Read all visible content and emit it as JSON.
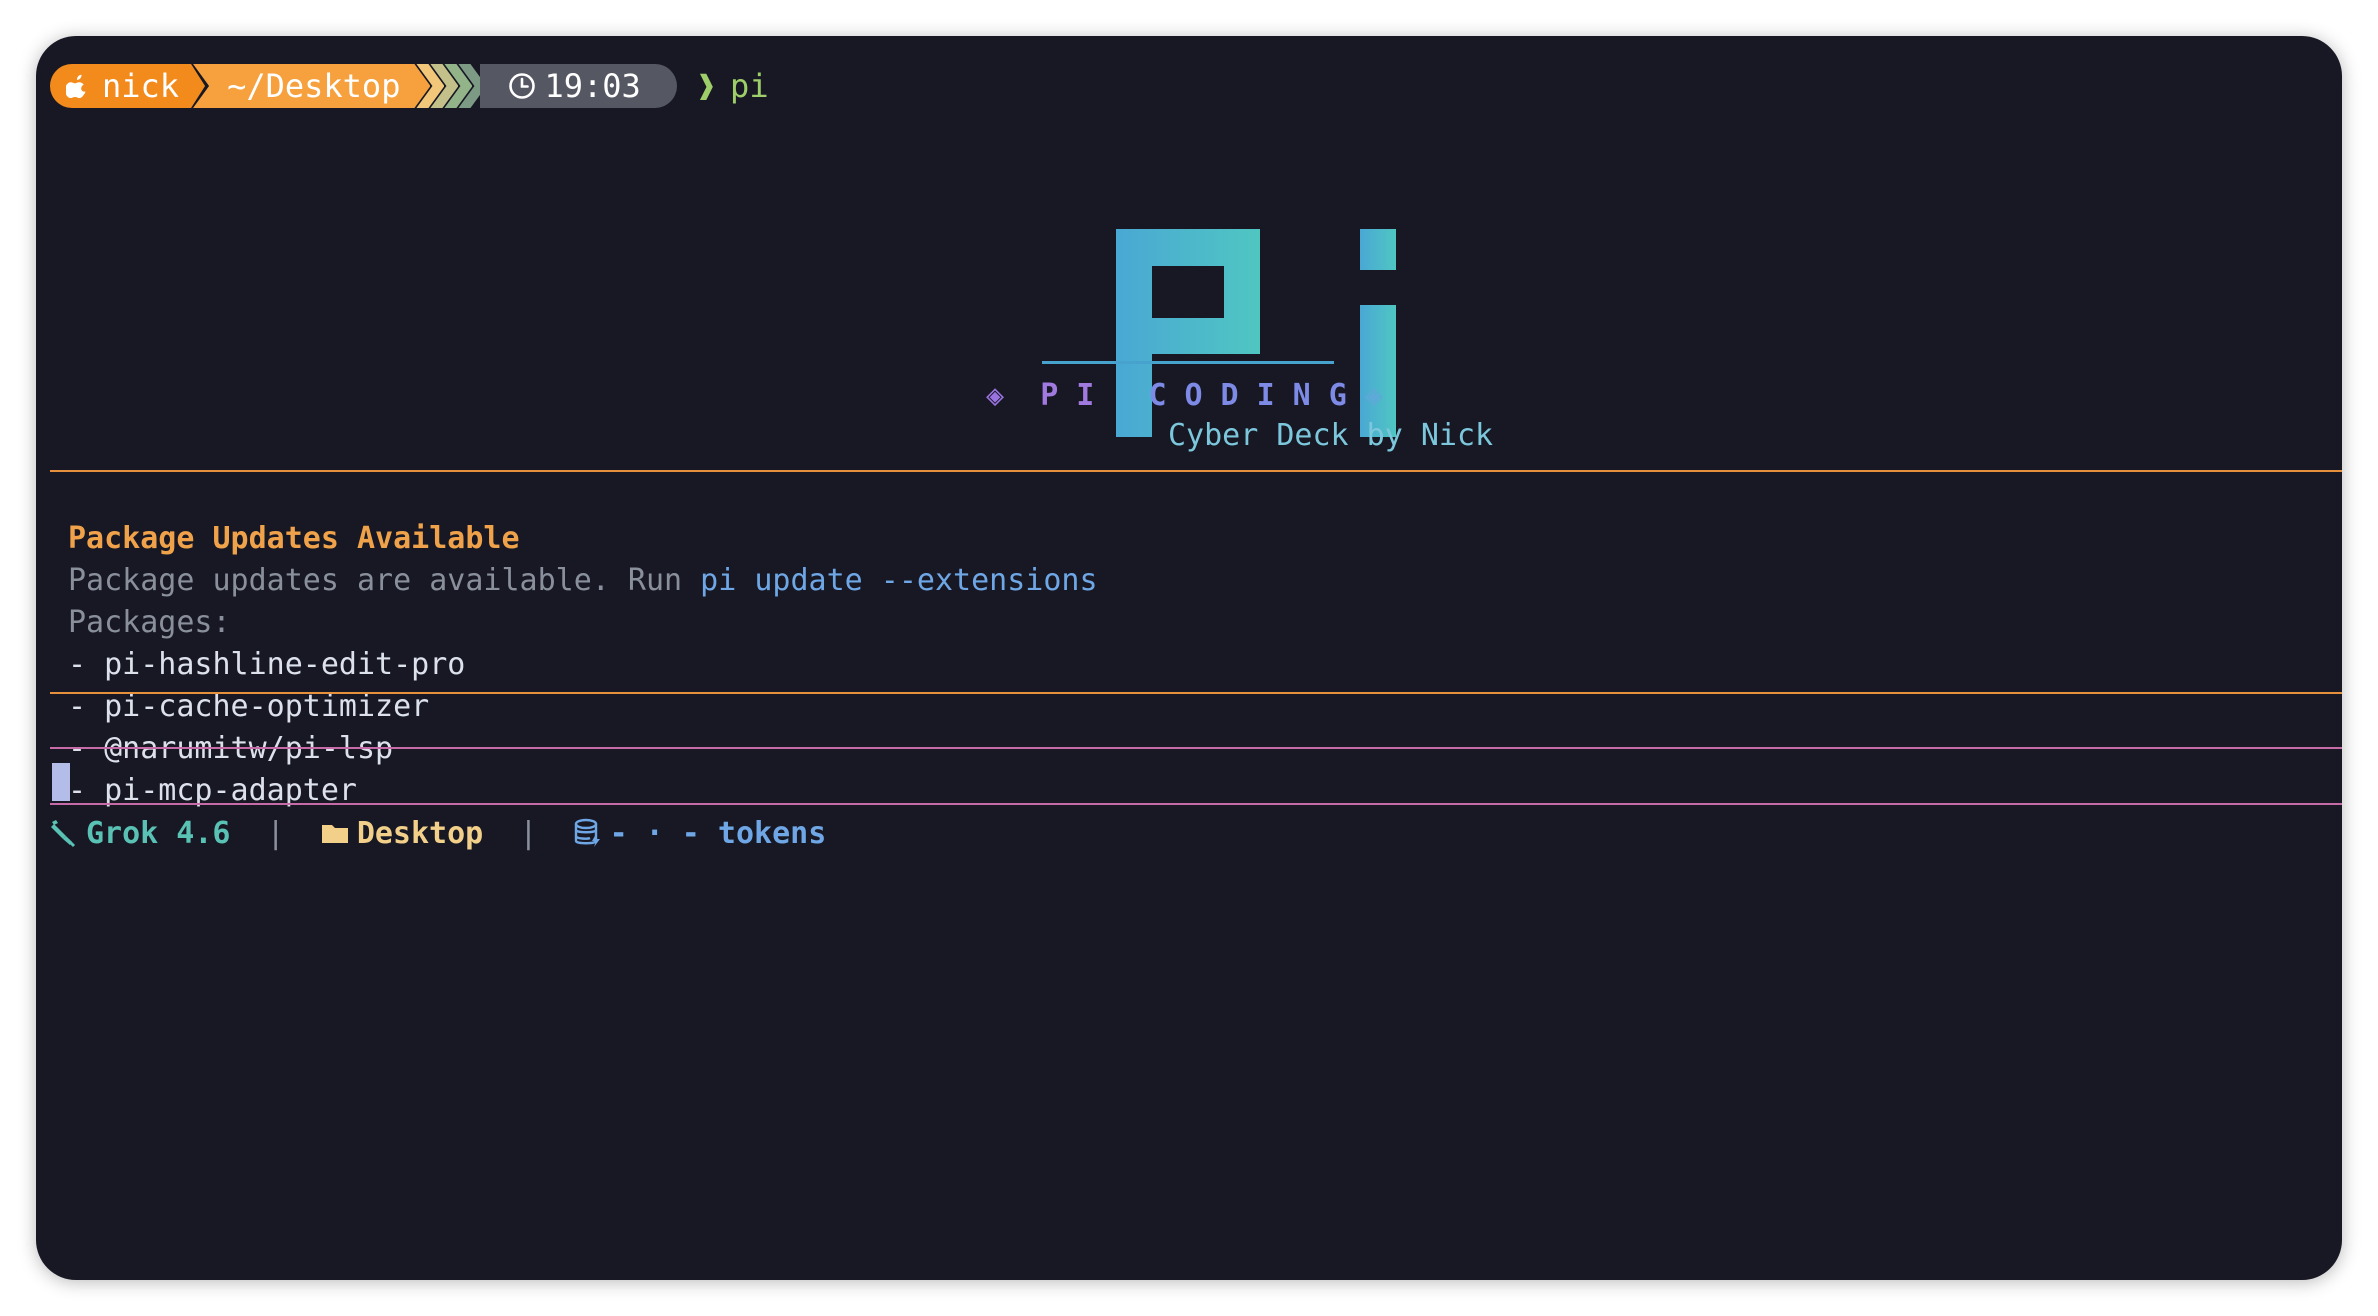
{
  "prompt": {
    "user": "nick",
    "directory": "~/Desktop",
    "time": "19:03",
    "arrow": "❱",
    "command": "pi",
    "icons": [
      "apple-icon",
      "clock-icon"
    ]
  },
  "logo": {
    "title_left": "PI",
    "title_right": "CODING",
    "diamond": "◈",
    "subtitle": "Cyber Deck by Nick",
    "colors": {
      "gradient_start": "#4aa8d4",
      "gradient_end": "#4fc6c2",
      "title_start": "#a17ae0",
      "title_end": "#6f8be8"
    }
  },
  "updates": {
    "title": "Package Updates Available",
    "message_prefix": "Package updates are available. Run ",
    "command": "pi update --extensions",
    "packages_label": "Packages:",
    "packages": [
      "- pi-hashline-edit-pro",
      "- pi-cache-optimizer",
      "- @narumitw/pi-lsp",
      "- pi-mcp-adapter"
    ]
  },
  "status": {
    "model": "Grok 4.6",
    "separator": "|",
    "directory": "Desktop",
    "tokens": "- · - tokens",
    "icons": [
      "rocket-icon",
      "folder-icon",
      "database-icon"
    ]
  }
}
